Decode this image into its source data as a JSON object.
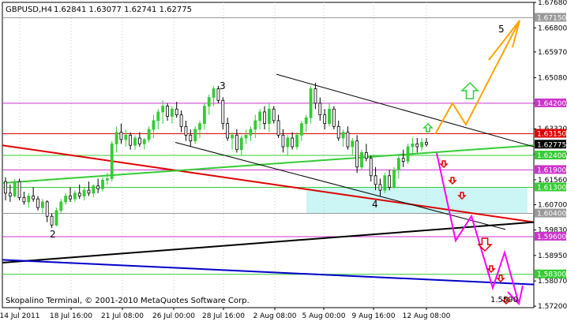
{
  "header": {
    "symbol": "GBPUSD,H4",
    "ohlc": "1.62841 1.63077 1.62741 1.62775"
  },
  "footer": {
    "copyright": "Skopalino Terminal, © 2001-2010 MetaQuotes Software Corp."
  },
  "colors": {
    "bull": "#33cc33",
    "bear": "#000000",
    "grid": "#c8c8c8",
    "red_line": "#e00000",
    "green_line": "#33cc33",
    "blue_line": "#0000cc",
    "black_line": "#000000",
    "orange_path": "#ffa500",
    "magenta_path": "#ff00ff",
    "zone": "#ccf5f5"
  },
  "chart_data": {
    "type": "candlestick",
    "ylim": [
      1.5715,
      1.6768
    ],
    "y_ticks": [
      "1.67680",
      "1.66800",
      "1.65970",
      "1.65080",
      "1.64200",
      "1.63320",
      "1.62440",
      "1.61560",
      "1.60700",
      "1.59830",
      "1.58950",
      "1.58070",
      "1.57200"
    ],
    "x_ticks": [
      "14 Jul 2011",
      "18 Jul 16:00",
      "21 Jul 08:00",
      "26 Jul 00:00",
      "28 Jul 16:00",
      "2 Aug 08:00",
      "5 Aug 00:00",
      "9 Aug 16:00",
      "12 Aug 08:00"
    ],
    "current_price": "1.62775",
    "levels": [
      {
        "value": 1.6715,
        "label": "1.67150",
        "color": "#999999"
      },
      {
        "value": 1.642,
        "label": "1.64200",
        "color": "#cc33cc"
      },
      {
        "value": 1.6315,
        "label": "1.63150",
        "color": "#e00000"
      },
      {
        "value": 1.624,
        "label": "1.62400",
        "color": "#33cc33"
      },
      {
        "value": 1.619,
        "label": "1.61900",
        "color": "#cc33cc"
      },
      {
        "value": 1.613,
        "label": "1.61300",
        "color": "#33cc33"
      },
      {
        "value": 1.604,
        "label": "1.60400",
        "color": "#999999"
      },
      {
        "value": 1.596,
        "label": "1.59600",
        "color": "#cc33cc"
      },
      {
        "value": 1.583,
        "label": "1.58300",
        "color": "#33cc33"
      }
    ],
    "wave_labels": [
      "2",
      "3",
      "4",
      "5"
    ],
    "target_label": "1.5590"
  }
}
